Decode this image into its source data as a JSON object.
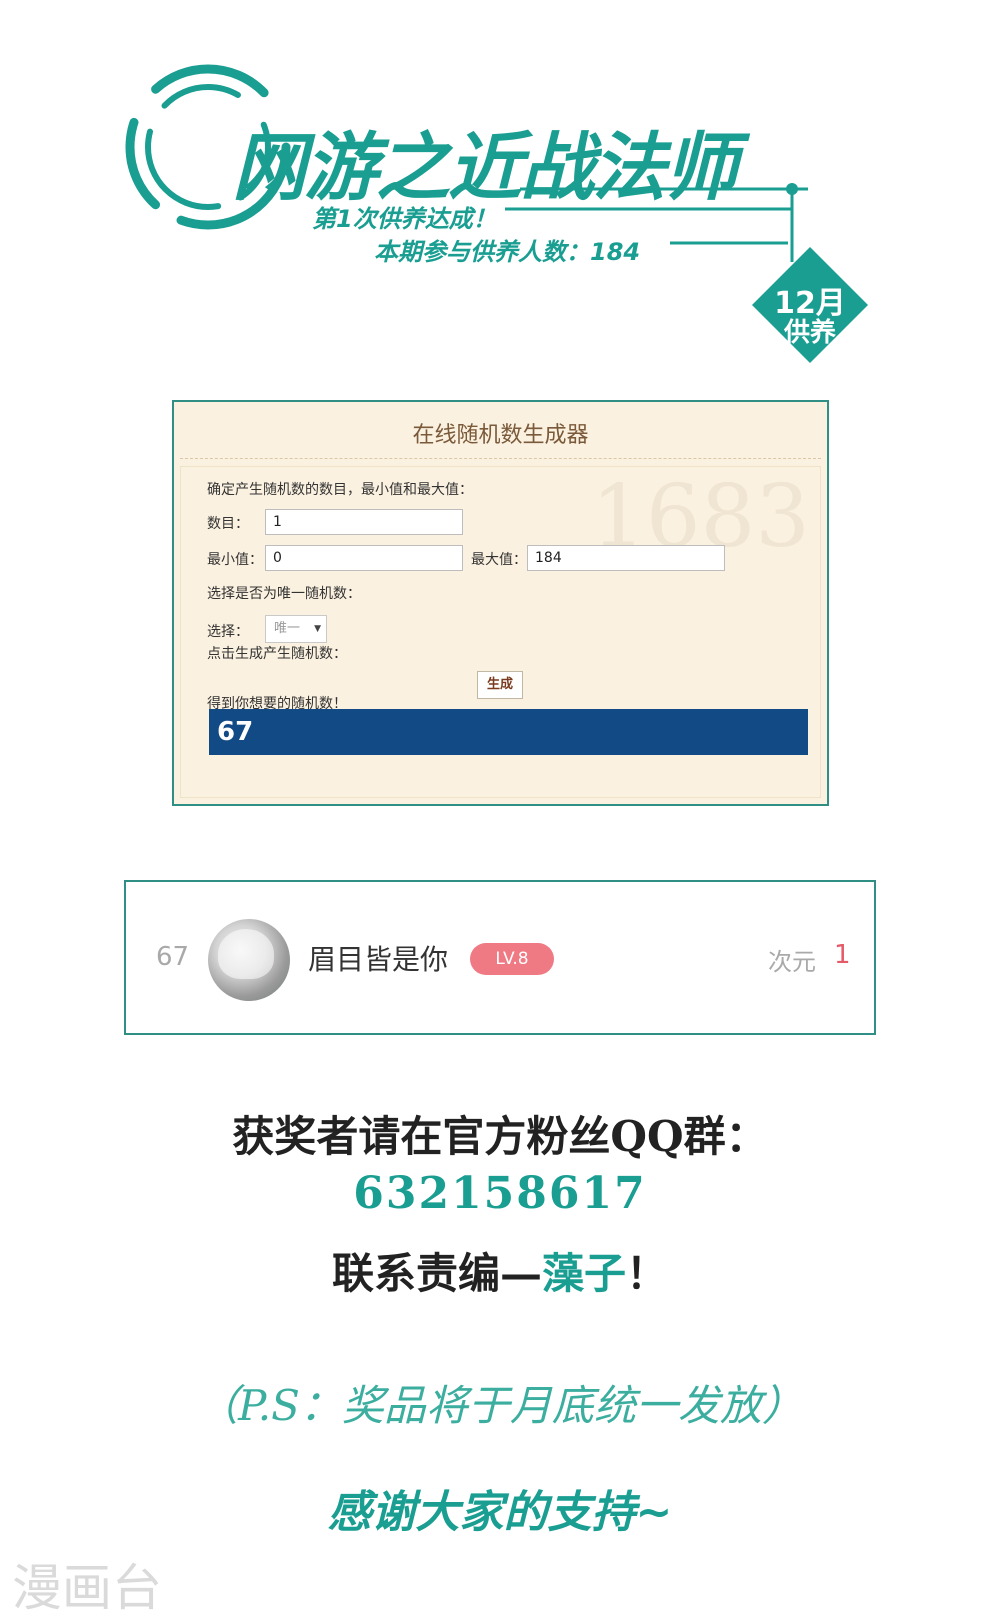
{
  "banner": {
    "title": "网游之近战法师",
    "line1": "第1次供养达成！",
    "line2": "本期参与供养人数：184",
    "badge_month": "12月",
    "badge_label": "供养"
  },
  "generator": {
    "title": "在线随机数生成器",
    "instruction": "确定产生随机数的数目，最小值和最大值：",
    "count_label": "数目：",
    "count_value": "1",
    "min_label": "最小值：",
    "min_value": "0",
    "max_label": "最大值：",
    "max_value": "184",
    "unique_prompt": "选择是否为唯一随机数：",
    "select_label": "选择：",
    "select_value": "唯一",
    "click_prompt": "点击生成产生随机数：",
    "generate_label": "生成",
    "result_prompt": "得到你想要的随机数！",
    "result_value": "67"
  },
  "winner": {
    "rank": "67",
    "username": "眉目皆是你",
    "level": "LV.8",
    "currency_label": "次元",
    "currency_value": "1"
  },
  "announcement": {
    "line1": "获奖者请在官方粉丝QQ群：",
    "group_number": "632158617",
    "line3_prefix": "联系责编—",
    "editor_name": "藻子",
    "line3_suffix": "！",
    "ps": "（P.S：奖品将于月底统一发放）",
    "thanks": "感谢大家的支持~"
  },
  "watermark": "漫画台",
  "colors": {
    "accent": "#1a9e92",
    "result_bg": "#124a85",
    "level_badge": "#f07a84",
    "currency_value": "#e55a68"
  }
}
